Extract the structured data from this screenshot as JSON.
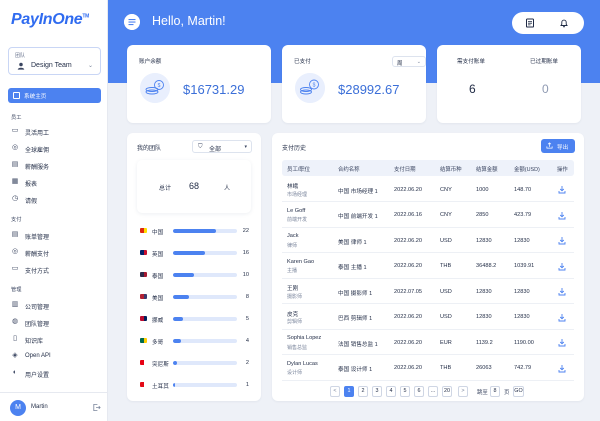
{
  "brand": {
    "logo": "PayInOne",
    "tm": "TM"
  },
  "team_selector": {
    "caption": "团队",
    "name": "Design Team"
  },
  "nav": {
    "home": "系统主页",
    "sections": [
      {
        "title": "员工",
        "items": [
          "灵活用工",
          "全球雇佣",
          "薪酬服务",
          "报表",
          "请假"
        ]
      },
      {
        "title": "支付",
        "items": [
          "账单管理",
          "薪酬支付",
          "支付方式"
        ]
      },
      {
        "title": "管理",
        "items": [
          "公司管理",
          "团队管理",
          "知识库",
          "Open API",
          "用户设置"
        ]
      }
    ]
  },
  "user": {
    "initial": "M",
    "name": "Martin"
  },
  "header": {
    "greeting": "Hello, Martin!"
  },
  "stats": {
    "balance": {
      "label": "账户余额",
      "value": "$16731.29"
    },
    "paid": {
      "label": "已支付",
      "value": "$28992.67",
      "period": "周"
    },
    "to_pay": {
      "label": "需支付账单",
      "value": "6"
    },
    "overdue": {
      "label": "已过期账单",
      "value": "0"
    }
  },
  "team": {
    "title": "我的团队",
    "filter": "全部",
    "total_label": "总计",
    "total_value": "68",
    "total_unit": "人",
    "countries": [
      {
        "name": "中国",
        "count": "22",
        "fraction": 0.667,
        "flag_colors": [
          "#de2910",
          "#ffde00"
        ]
      },
      {
        "name": "英国",
        "count": "16",
        "fraction": 0.5,
        "flag_colors": [
          "#012169",
          "#c8102e"
        ]
      },
      {
        "name": "泰国",
        "count": "10",
        "fraction": 0.333,
        "flag_colors": [
          "#2d2a4a",
          "#a51931"
        ]
      },
      {
        "name": "美国",
        "count": "8",
        "fraction": 0.25,
        "flag_colors": [
          "#b22234",
          "#3c3b6e"
        ]
      },
      {
        "name": "挪威",
        "count": "5",
        "fraction": 0.16,
        "flag_colors": [
          "#ba0c2f",
          "#00205b"
        ]
      },
      {
        "name": "多哥",
        "count": "4",
        "fraction": 0.12,
        "flag_colors": [
          "#006a4e",
          "#ffce00"
        ]
      },
      {
        "name": "突尼斯",
        "count": "2",
        "fraction": 0.06,
        "flag_colors": [
          "#e70013",
          "#ffffff"
        ]
      },
      {
        "name": "土耳其",
        "count": "1",
        "fraction": 0.03,
        "flag_colors": [
          "#e30a17",
          "#ffffff"
        ]
      }
    ]
  },
  "payments": {
    "title": "支付历史",
    "export_label": "导出",
    "columns": [
      "员工/职位",
      "合约名称",
      "支付日期",
      "结算币种",
      "结算金额",
      "金额(USD)",
      "操作"
    ],
    "rows": [
      {
        "name": "林峨",
        "title": "市场经理",
        "contract": "中国 市场经理 1",
        "date": "2022.06.20",
        "currency": "CNY",
        "amount": "1000",
        "usd": "148.70"
      },
      {
        "name": "Le Goff",
        "title": "前端开发",
        "contract": "中国 前端开发 1",
        "date": "2022.06.16",
        "currency": "CNY",
        "amount": "2850",
        "usd": "423.79"
      },
      {
        "name": "Jack",
        "title": "律师",
        "contract": "美国 律师 1",
        "date": "2022.06.20",
        "currency": "USD",
        "amount": "12830",
        "usd": "12830"
      },
      {
        "name": "Karen Gao",
        "title": "主播",
        "contract": "泰国 主播 1",
        "date": "2022.06.20",
        "currency": "THB",
        "amount": "36488.2",
        "usd": "1039.91"
      },
      {
        "name": "王刚",
        "title": "摄影师",
        "contract": "中国 摄影师 1",
        "date": "2022.07.05",
        "currency": "USD",
        "amount": "12830",
        "usd": "12830"
      },
      {
        "name": "皮克",
        "title": "剪辑师",
        "contract": "巴西 剪辑师 1",
        "date": "2022.06.20",
        "currency": "USD",
        "amount": "12830",
        "usd": "12830"
      },
      {
        "name": "Sophia Lopez",
        "title": "销售总监",
        "contract": "法国 销售总监 1",
        "date": "2022.06.20",
        "currency": "EUR",
        "amount": "1139.2",
        "usd": "1190.00"
      },
      {
        "name": "Dylan Lucas",
        "title": "设计师",
        "contract": "泰国 设计师 1",
        "date": "2022.06.20",
        "currency": "THB",
        "amount": "26063",
        "usd": "742.79"
      }
    ]
  },
  "pagination": {
    "prev": "<",
    "next": ">",
    "pages": [
      "1",
      "2",
      "3",
      "4",
      "5",
      "6",
      "...",
      "20"
    ],
    "active_page": "1",
    "jump_label": "跳至",
    "jump_value": "8",
    "jump_unit": "页",
    "go_label": "GO"
  },
  "colors": {
    "accent": "#4c82f0",
    "background": "#eef1f7",
    "value_blue": "#3b6fd8"
  }
}
